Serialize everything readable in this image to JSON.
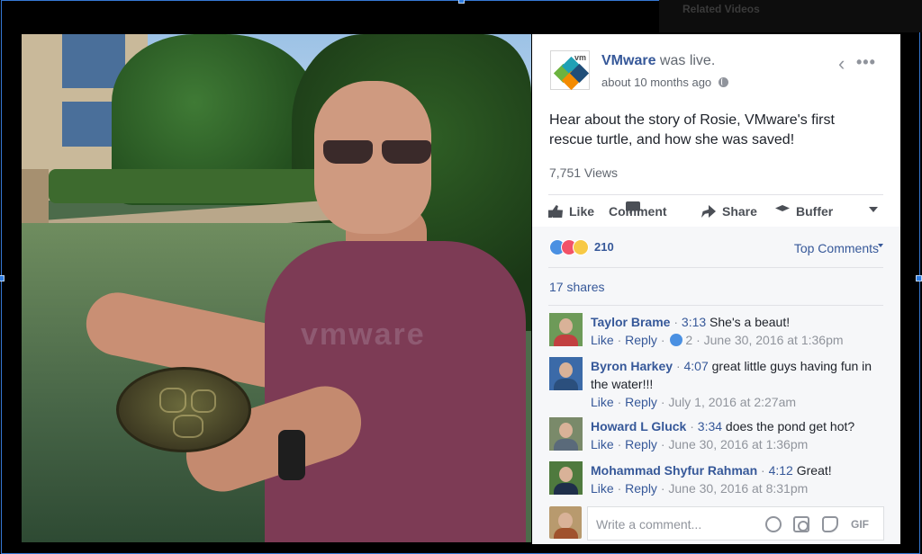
{
  "related": {
    "title": "Related Videos"
  },
  "post": {
    "author": "VMware",
    "action": "was live.",
    "timestamp": "about 10 months ago",
    "logo_text": "vm",
    "text": "Hear about the story of Rosie, VMware's first rescue turtle, and how she was saved!",
    "views": "7,751 Views"
  },
  "video": {
    "shirt_logo": "vmware"
  },
  "actions": {
    "like": "Like",
    "comment": "Comment",
    "share": "Share",
    "buffer": "Buffer"
  },
  "reactions": {
    "count": "210",
    "sort_label": "Top Comments"
  },
  "shares": "17 shares",
  "comments": [
    {
      "name": "Taylor Brame",
      "ts": "3:13",
      "text": "She's a beaut!",
      "like": "Like",
      "reply": "Reply",
      "likes_count": "2",
      "date": "June 30, 2016 at 1:36pm"
    },
    {
      "name": "Byron Harkey",
      "ts": "4:07",
      "text": "great little guys having fun in the water!!!",
      "like": "Like",
      "reply": "Reply",
      "date": "July 1, 2016 at 2:27am"
    },
    {
      "name": "Howard L Gluck",
      "ts": "3:34",
      "text": "does the pond get hot?",
      "like": "Like",
      "reply": "Reply",
      "date": "June 30, 2016 at 1:36pm"
    },
    {
      "name": "Mohammad Shyfur Rahman",
      "ts": "4:12",
      "text": "Great!",
      "like": "Like",
      "reply": "Reply",
      "date": "June 30, 2016 at 8:31pm"
    }
  ],
  "composer": {
    "placeholder": "Write a comment...",
    "gif": "GIF"
  },
  "colors": {
    "link": "#365899",
    "muted": "#90949c",
    "selection": "#3578d4"
  }
}
